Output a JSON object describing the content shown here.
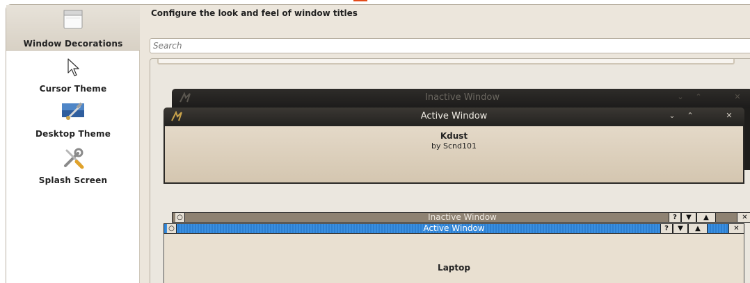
{
  "sidebar": {
    "items": [
      {
        "label": "Window Decorations",
        "icon": "window-icon",
        "selected": true
      },
      {
        "label": "Cursor Theme",
        "icon": "cursor-icon",
        "selected": false
      },
      {
        "label": "Desktop Theme",
        "icon": "desktop-icon",
        "selected": false
      },
      {
        "label": "Splash Screen",
        "icon": "tools-icon",
        "selected": false
      }
    ]
  },
  "header": {
    "title": "Configure the look and feel of window titles"
  },
  "search": {
    "placeholder": "Search"
  },
  "themes": [
    {
      "name": "Kdust",
      "author": "by Scnd101",
      "inactive_title": "Inactive Window",
      "active_title": "Active Window"
    },
    {
      "name": "Laptop",
      "inactive_title": "Inactive Window",
      "active_title": "Active Window",
      "help_glyph": "?",
      "close_glyph": "✕"
    }
  ],
  "colors": {
    "selected_bg": "#d8d1c5",
    "kdust_titlebar": "#2b2926",
    "laptop_active": "#3a8fe0",
    "laptop_inactive": "#8e8272"
  }
}
